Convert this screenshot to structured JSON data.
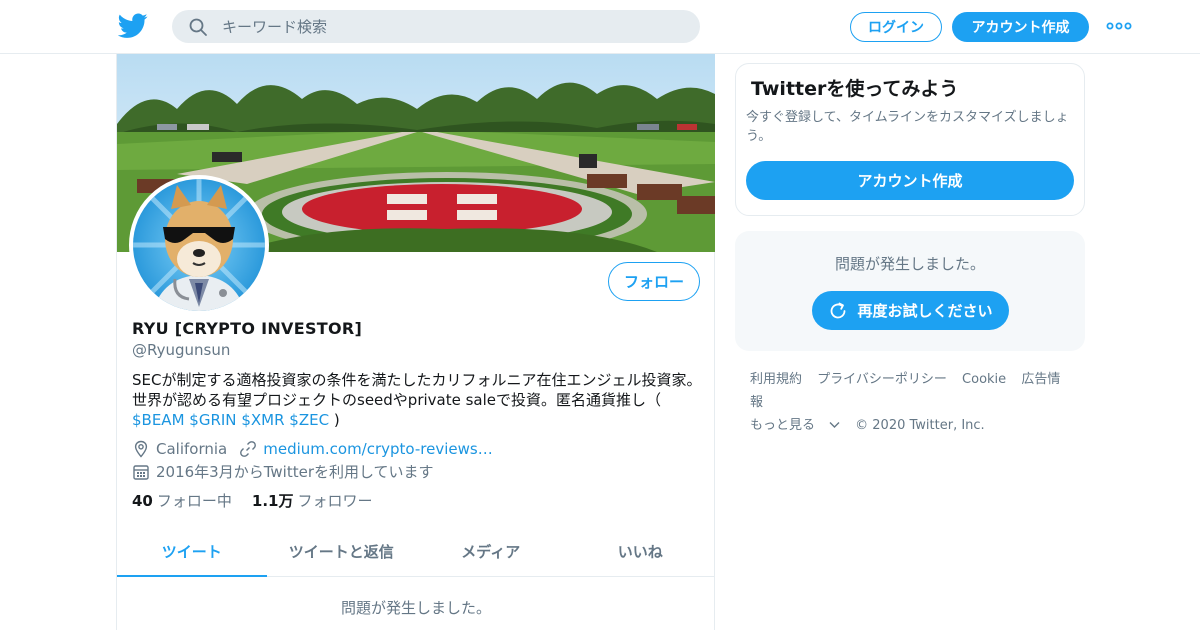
{
  "header": {
    "search_placeholder": "キーワード検索",
    "login_label": "ログイン",
    "signup_label": "アカウント作成"
  },
  "profile": {
    "name": "RYU [CRYPTO INVESTOR]",
    "handle": "@Ryugunsun",
    "follow_label": "フォロー",
    "bio_text": "SECが制定する適格投資家の条件を満たしたカリフォルニア在住エンジェル投資家。 世界が認める有望プロジェクトのseedやprivate saleで投資。匿名通貨推し（",
    "bio_tags": [
      "$BEAM",
      "$GRIN",
      "$XMR",
      "$ZEC"
    ],
    "bio_end": ")",
    "location": "California",
    "website": "medium.com/crypto-reviews…",
    "joined": "2016年3月からTwitterを利用しています",
    "following_count": "40",
    "following_label": "フォロー中",
    "followers_count": "1.1万",
    "followers_label": "フォロワー"
  },
  "tabs": [
    {
      "label": "ツイート",
      "active": true
    },
    {
      "label": "ツイートと返信",
      "active": false
    },
    {
      "label": "メディア",
      "active": false
    },
    {
      "label": "いいね",
      "active": false
    }
  ],
  "main_error": "問題が発生しました。",
  "sidebar": {
    "try_title": "Twitterを使ってみよう",
    "try_desc": "今すぐ登録して、タイムラインをカスタマイズしましょう。",
    "try_button": "アカウント作成",
    "error_text": "問題が発生しました。",
    "retry_label": "再度お試しください"
  },
  "footer": {
    "links": [
      "利用規約",
      "プライバシーポリシー",
      "Cookie",
      "広告情報"
    ],
    "more": "もっと見る",
    "copyright": "© 2020 Twitter, Inc."
  },
  "colors": {
    "accent": "#1da1f2",
    "link": "#1b95e0",
    "muted": "#657786",
    "border": "#e6ecf0"
  },
  "icons": [
    "twitter-bird-icon",
    "search-icon",
    "more-dots-icon",
    "location-pin-icon",
    "link-icon",
    "calendar-icon",
    "refresh-icon",
    "chevron-down-icon"
  ]
}
